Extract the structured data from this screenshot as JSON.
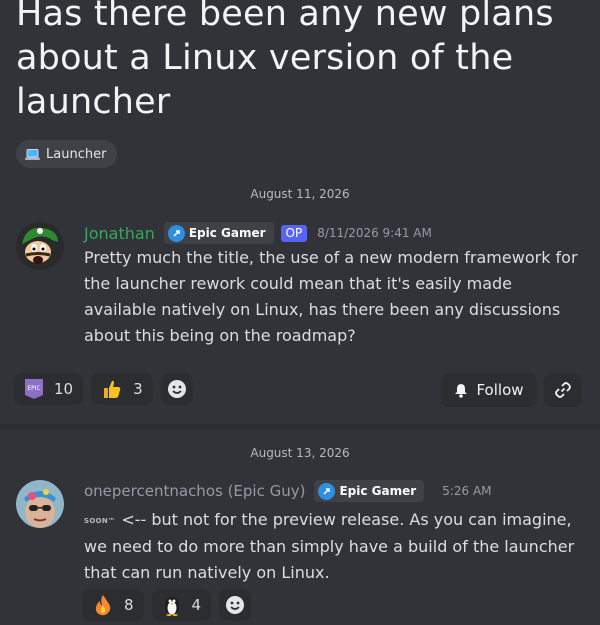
{
  "post": {
    "title": "Has there been any new plans about a Linux version of the launcher",
    "tag": {
      "label": "Launcher",
      "icon": "laptop-icon"
    }
  },
  "messages": [
    {
      "date_separator": "August 11, 2026",
      "author": "Jonathan",
      "author_color": "#3ba55d",
      "role_badge": "Epic Gamer",
      "op_label": "OP",
      "timestamp": "8/11/2026 9:41 AM",
      "text": "Pretty much the title, the use of a new modern framework for the launcher rework could mean that it's easily made available natively on Linux, has there been any discussions about this being on the roadmap?",
      "reactions": [
        {
          "emoji": "epic-emoji",
          "count": "10"
        },
        {
          "emoji": "thumbs-up",
          "count": "3"
        }
      ]
    },
    {
      "date_separator": "August 13, 2026",
      "author": "onepercentnachos (Epic Guy)",
      "author_color": "#949ba4",
      "role_badge": "Epic Gamer",
      "timestamp": "5:26 AM",
      "inline_emoji_text": "SOON™",
      "text": "<-- but not for the preview release. As you can imagine, we need to do more than simply have a build of the launcher that can run natively on Linux.",
      "reactions": [
        {
          "emoji": "fire",
          "count": "8"
        },
        {
          "emoji": "penguin",
          "count": "4"
        }
      ]
    }
  ],
  "actions": {
    "follow_label": "Follow"
  },
  "colors": {
    "background": "#313338",
    "accent": "#5865f2",
    "badge_blue": "#2f8fe0"
  }
}
